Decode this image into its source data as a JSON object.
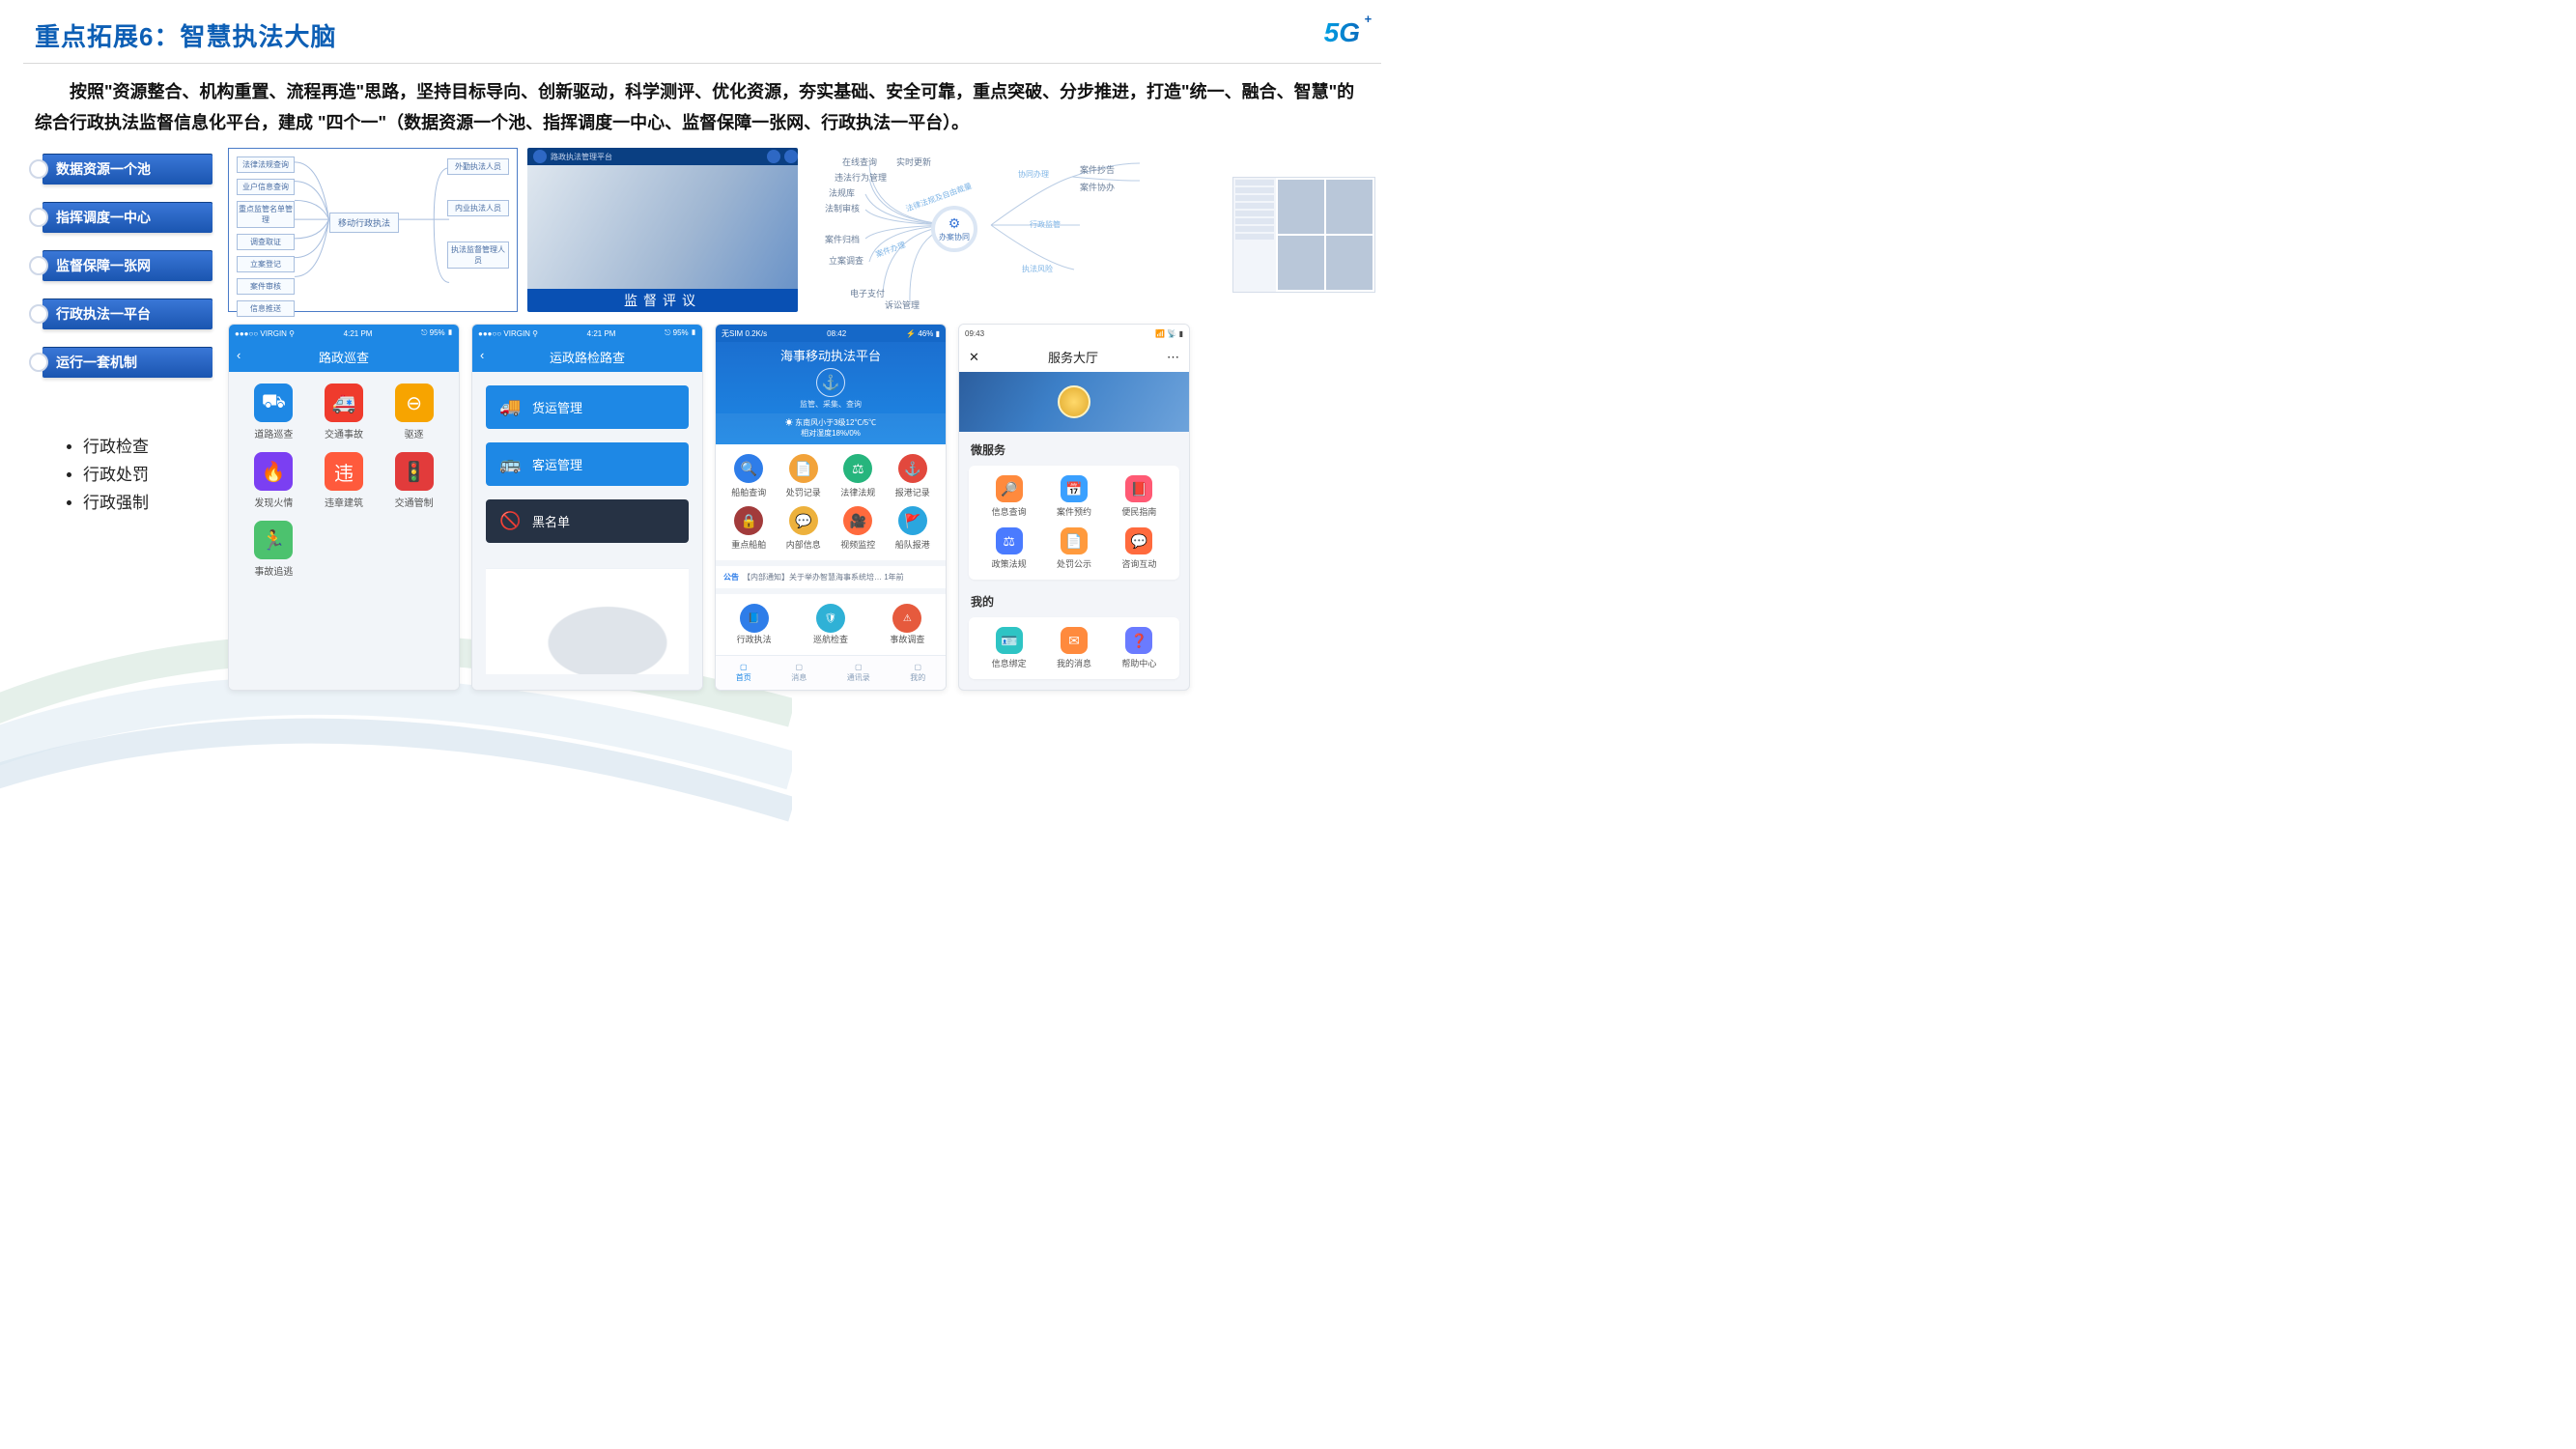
{
  "slide": {
    "title": "重点拓展6：智慧执法大脑",
    "logo": "5G",
    "paragraph": "按照\"资源整合、机构重置、流程再造\"思路，坚持目标导向、创新驱动，科学测评、优化资源，夯实基础、安全可靠，重点突破、分步推进，打造\"统一、融合、智慧\"的综合行政执法监督信息化平台，建成 \"四个一\"（数据资源一个池、指挥调度一中心、监督保障一张网、行政执法一平台）。"
  },
  "pillars": [
    "数据资源一个池",
    "指挥调度一中心",
    "监督保障一张网",
    "行政执法一平台",
    "运行一套机制"
  ],
  "bullets": [
    "行政检查",
    "行政处罚",
    "行政强制"
  ],
  "tree": {
    "center": "移动行政执法",
    "left": [
      "法律法规查询",
      "业户信息查询",
      "重点监管名单管理",
      "调查取证",
      "立案登记",
      "案件审核",
      "信息推送"
    ],
    "right": [
      "外勤执法人员",
      "内业执法人员",
      "执法监督管理人员"
    ]
  },
  "map": {
    "title": "路政执法管理平台",
    "bottom": "监督评议"
  },
  "mind": {
    "hub": "办案协同",
    "center_link": "法律法规及自由裁量",
    "left_group_title": "案件办理",
    "left": [
      "在线查询",
      "违法行为管理",
      "法规库",
      "法制审核",
      "案件归档",
      "立案调查",
      "电子支付",
      "诉讼管理"
    ],
    "left_extra": "实时更新",
    "right": [
      {
        "stem": "协同办理",
        "leaves": [
          "案件抄告",
          "案件协办"
        ]
      },
      {
        "stem": "行政监管",
        "leaves": []
      },
      {
        "stem": "执法风险",
        "leaves": []
      }
    ]
  },
  "phone1": {
    "carrier": "VIRGIN",
    "time": "4:21 PM",
    "batt": "95%",
    "title": "路政巡查",
    "items": [
      {
        "label": "道路巡查",
        "color": "#1e88e5",
        "glyph": "⛟"
      },
      {
        "label": "交通事故",
        "color": "#ef3b2d",
        "glyph": "🚑"
      },
      {
        "label": "驱逐",
        "color": "#f7a400",
        "glyph": "⊖"
      },
      {
        "label": "发现火情",
        "color": "#7b3ff2",
        "glyph": "🔥"
      },
      {
        "label": "违章建筑",
        "color": "#ff5a3c",
        "glyph": "违"
      },
      {
        "label": "交通管制",
        "color": "#e23b3b",
        "glyph": "🚦"
      },
      {
        "label": "事故追逃",
        "color": "#4cc26e",
        "glyph": "🏃"
      }
    ]
  },
  "phone2": {
    "carrier": "VIRGIN",
    "time": "4:21 PM",
    "batt": "95%",
    "title": "运政路检路查",
    "rows": [
      {
        "label": "货运管理",
        "glyph": "🚚",
        "dark": false
      },
      {
        "label": "客运管理",
        "glyph": "🚌",
        "dark": false
      },
      {
        "label": "黑名单",
        "glyph": "🚫",
        "dark": true
      }
    ]
  },
  "phone3": {
    "status_left": "无SIM 0.2K/s",
    "time": "08:42",
    "status_right": "46%",
    "title": "海事移动执法平台",
    "subtitle": "监管、采集、查询",
    "weather1": "东南风小于3级12℃/5℃",
    "weather2": "相对湿度18%/0%",
    "grid": [
      {
        "label": "船舶查询",
        "color": "#2e7de9",
        "glyph": "🔍"
      },
      {
        "label": "处罚记录",
        "color": "#f2a33a",
        "glyph": "📄"
      },
      {
        "label": "法律法规",
        "color": "#26b57d",
        "glyph": "⚖"
      },
      {
        "label": "报港记录",
        "color": "#e2483d",
        "glyph": "⚓"
      },
      {
        "label": "重点船舶",
        "color": "#a23b3b",
        "glyph": "🔒"
      },
      {
        "label": "内部信息",
        "color": "#edb13c",
        "glyph": "💬"
      },
      {
        "label": "视频监控",
        "color": "#ff6a3d",
        "glyph": "🎥"
      },
      {
        "label": "船队报港",
        "color": "#2aa6df",
        "glyph": "🚩"
      }
    ],
    "notice": "【内部通知】关于举办智慧海事系统培… 1年前",
    "row3": [
      {
        "label": "行政执法",
        "glyph": "📘",
        "color": "#2e7de9"
      },
      {
        "label": "巡航检查",
        "glyph": "🛡",
        "color": "#2fb1d6"
      },
      {
        "label": "事故调查",
        "glyph": "⚠",
        "color": "#e65a3d"
      }
    ],
    "tabs": [
      "首页",
      "消息",
      "通讯录",
      "我的"
    ]
  },
  "phone4": {
    "time": "09:43",
    "title": "服务大厅",
    "section1": "微服务",
    "grid": [
      {
        "label": "信息查询",
        "color": "#ff8a3d",
        "glyph": "🔎"
      },
      {
        "label": "案件预约",
        "color": "#3aa0ff",
        "glyph": "📅"
      },
      {
        "label": "便民指南",
        "color": "#ff5a74",
        "glyph": "📕"
      },
      {
        "label": "政策法规",
        "color": "#4a7bff",
        "glyph": "⚖"
      },
      {
        "label": "处罚公示",
        "color": "#ff9a3d",
        "glyph": "📄"
      },
      {
        "label": "咨询互动",
        "color": "#ff6a3d",
        "glyph": "💬"
      }
    ],
    "section2": "我的",
    "grid2": [
      {
        "label": "信息绑定",
        "color": "#2ec4c4",
        "glyph": "🪪"
      },
      {
        "label": "我的消息",
        "color": "#ff8a3d",
        "glyph": "✉"
      },
      {
        "label": "帮助中心",
        "color": "#6a7bff",
        "glyph": "❓"
      }
    ]
  }
}
